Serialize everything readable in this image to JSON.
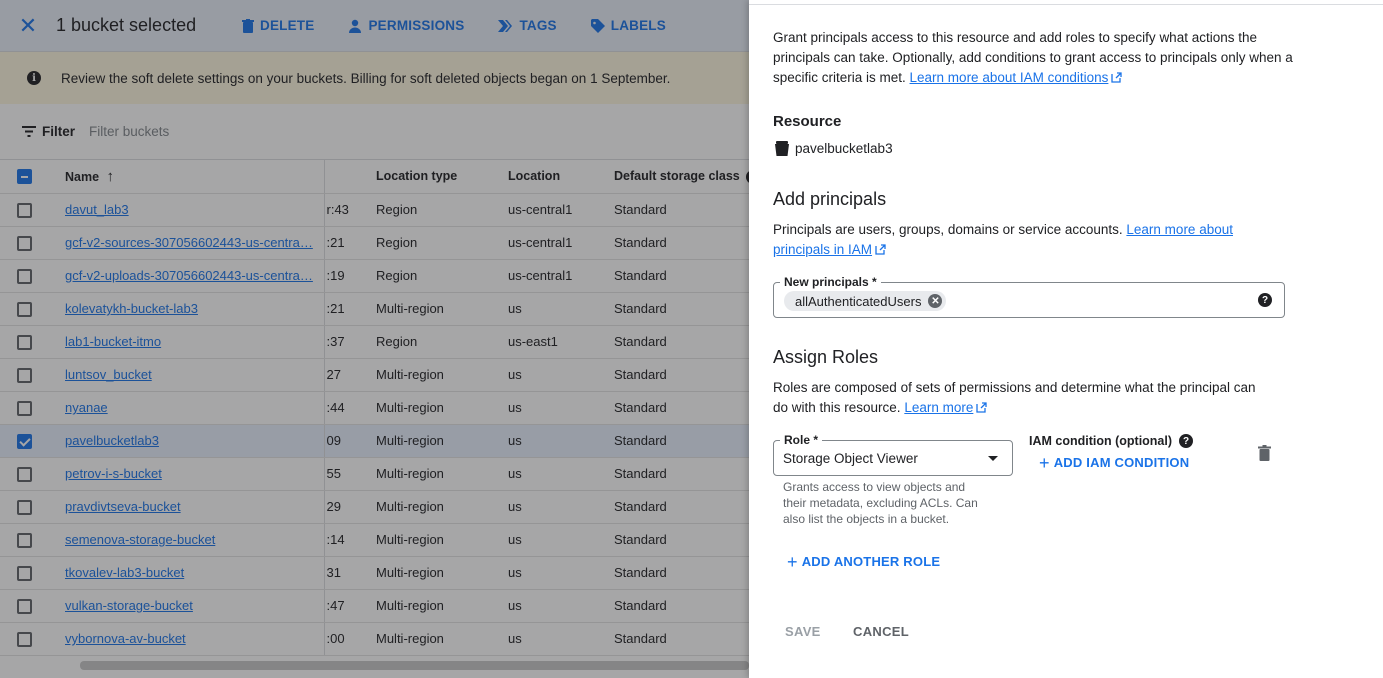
{
  "toolbar": {
    "selection_label": "1 bucket selected",
    "delete_label": "DELETE",
    "permissions_label": "PERMISSIONS",
    "tags_label": "TAGS",
    "labels_label": "LABELS"
  },
  "banner": {
    "text": "Review the soft delete settings on your buckets. Billing for soft deleted objects began on 1 September."
  },
  "filter": {
    "label": "Filter",
    "placeholder": "Filter buckets"
  },
  "table": {
    "headers": {
      "name": "Name",
      "location_type": "Location type",
      "location": "Location",
      "storage_class": "Default storage class"
    },
    "rows": [
      {
        "name": "davut_lab3",
        "created": "r:43",
        "location_type": "Region",
        "location": "us-central1",
        "storage_class": "Standard",
        "selected": false
      },
      {
        "name": "gcf-v2-sources-307056602443-us-centra…",
        "created": ":21",
        "location_type": "Region",
        "location": "us-central1",
        "storage_class": "Standard",
        "selected": false
      },
      {
        "name": "gcf-v2-uploads-307056602443-us-centra…",
        "created": ":19",
        "location_type": "Region",
        "location": "us-central1",
        "storage_class": "Standard",
        "selected": false
      },
      {
        "name": "kolevatykh-bucket-lab3",
        "created": ":21",
        "location_type": "Multi-region",
        "location": "us",
        "storage_class": "Standard",
        "selected": false
      },
      {
        "name": "lab1-bucket-itmo",
        "created": ":37",
        "location_type": "Region",
        "location": "us-east1",
        "storage_class": "Standard",
        "selected": false
      },
      {
        "name": "luntsov_bucket",
        "created": "27",
        "location_type": "Multi-region",
        "location": "us",
        "storage_class": "Standard",
        "selected": false
      },
      {
        "name": "nyanae",
        "created": ":44",
        "location_type": "Multi-region",
        "location": "us",
        "storage_class": "Standard",
        "selected": false
      },
      {
        "name": "pavelbucketlab3",
        "created": "09",
        "location_type": "Multi-region",
        "location": "us",
        "storage_class": "Standard",
        "selected": true
      },
      {
        "name": "petrov-i-s-bucket",
        "created": "55",
        "location_type": "Multi-region",
        "location": "us",
        "storage_class": "Standard",
        "selected": false
      },
      {
        "name": "pravdivtseva-bucket",
        "created": "29",
        "location_type": "Multi-region",
        "location": "us",
        "storage_class": "Standard",
        "selected": false
      },
      {
        "name": "semenova-storage-bucket",
        "created": ":14",
        "location_type": "Multi-region",
        "location": "us",
        "storage_class": "Standard",
        "selected": false
      },
      {
        "name": "tkovalev-lab3-bucket",
        "created": "31",
        "location_type": "Multi-region",
        "location": "us",
        "storage_class": "Standard",
        "selected": false
      },
      {
        "name": "vulkan-storage-bucket",
        "created": ":47",
        "location_type": "Multi-region",
        "location": "us",
        "storage_class": "Standard",
        "selected": false
      },
      {
        "name": "vybornova-av-bucket",
        "created": ":00",
        "location_type": "Multi-region",
        "location": "us",
        "storage_class": "Standard",
        "selected": false
      }
    ]
  },
  "panel": {
    "intro_text": "Grant principals access to this resource and add roles to specify what actions the principals can take. Optionally, add conditions to grant access to principals only when a specific criteria is met. ",
    "intro_link": "Learn more about IAM conditions",
    "resource_heading": "Resource",
    "resource_name": "pavelbucketlab3",
    "add_heading": "Add principals",
    "add_text": "Principals are users, groups, domains or service accounts. ",
    "add_link": "Learn more about principals in IAM",
    "principals_label": "New principals *",
    "principal_chip": "allAuthenticatedUsers",
    "assign_heading": "Assign Roles",
    "assign_text": "Roles are composed of sets of permissions and determine what the principal can do with this resource. ",
    "assign_link": "Learn more",
    "role_label": "Role *",
    "role_value": "Storage Object Viewer",
    "role_help": "Grants access to view objects and their metadata, excluding ACLs. Can also list the objects in a bucket.",
    "condition_label": "IAM condition (optional)",
    "add_condition": "ADD IAM CONDITION",
    "add_role": "ADD ANOTHER ROLE",
    "save": "SAVE",
    "cancel": "CANCEL"
  },
  "colors": {
    "accent": "#1a73e8",
    "text": "#202124",
    "muted": "#5f6368"
  }
}
